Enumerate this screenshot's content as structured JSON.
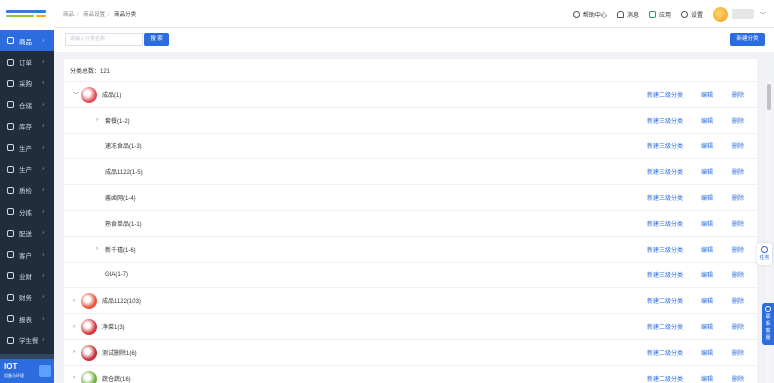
{
  "sidebar": {
    "items": [
      {
        "label": "商品",
        "active": true
      },
      {
        "label": "订单"
      },
      {
        "label": "采购"
      },
      {
        "label": "仓储"
      },
      {
        "label": "库存"
      },
      {
        "label": "生产"
      },
      {
        "label": "生产"
      },
      {
        "label": "质检"
      },
      {
        "label": "分拣"
      },
      {
        "label": "配送"
      },
      {
        "label": "客户"
      },
      {
        "label": "业财"
      },
      {
        "label": "财务"
      },
      {
        "label": "报表"
      },
      {
        "label": "学生餐"
      }
    ],
    "iot": {
      "title": "IOT",
      "subtitle": "设备与环境"
    }
  },
  "header": {
    "breadcrumb": [
      "商品",
      "商品设置",
      "商品分类"
    ],
    "actions": {
      "help": "帮助中心",
      "messages": "消息",
      "apps": "应用",
      "settings": "设置"
    }
  },
  "toolbar": {
    "search_placeholder": "请输入分类名称",
    "search_label": "搜 索",
    "new_label": "新建分类"
  },
  "main": {
    "total_text": "分类总数：121",
    "rows": [
      {
        "name": "成品(1)",
        "level": 1,
        "expander": "﹀",
        "thumb": "#e24d5a",
        "action": "新建二级分类"
      },
      {
        "name": "套餐(1-2)",
        "level": 2,
        "expander": "›",
        "action": "新建三级分类"
      },
      {
        "name": "速冻食品(1-3)",
        "level": 2,
        "action": "新建三级分类"
      },
      {
        "name": "成品1122(1-5)",
        "level": 2,
        "action": "新建三级分类"
      },
      {
        "name": "酱卤网(1-4)",
        "level": 2,
        "action": "新建三级分类"
      },
      {
        "name": "熟食单品(1-1)",
        "level": 2,
        "action": "新建三级分类"
      },
      {
        "name": "新千禧(1-6)",
        "level": 2,
        "expander": "›",
        "action": "新建三级分类"
      },
      {
        "name": "GIA(1-7)",
        "level": 2,
        "action": "新建三级分类"
      },
      {
        "name": "成品1122(103)",
        "level": 1,
        "expander": "›",
        "thumb": "#e9553c",
        "action": "新建二级分类"
      },
      {
        "name": "净菜1(3)",
        "level": 1,
        "expander": "›",
        "thumb": "#d8363b",
        "action": "新建二级分类"
      },
      {
        "name": "测试删除1(6)",
        "level": 1,
        "expander": "›",
        "thumb": "#c9303a",
        "action": "新建二级分类"
      },
      {
        "name": "蔬仓蔬(16)",
        "level": 1,
        "expander": "›",
        "thumb": "#6cb33e",
        "action": "新建二级分类"
      }
    ],
    "edit_label": "编辑",
    "delete_label": "删除"
  },
  "floats": {
    "task": "任务",
    "contact": [
      "联",
      "系",
      "客",
      "服"
    ]
  }
}
